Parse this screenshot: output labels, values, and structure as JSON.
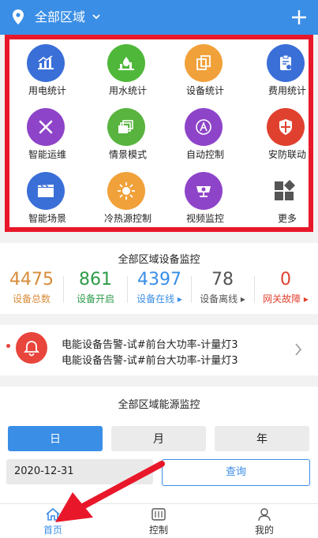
{
  "header": {
    "area_label": "全部区域"
  },
  "grid": [
    {
      "label": "用电统计",
      "icon": "power-chart-icon",
      "color": "#3a6fd8"
    },
    {
      "label": "用水统计",
      "icon": "water-chart-icon",
      "color": "#4fb83a"
    },
    {
      "label": "设备统计",
      "icon": "device-copy-icon",
      "color": "#f1a13a"
    },
    {
      "label": "费用统计",
      "icon": "clipboard-icon",
      "color": "#3a6fd8"
    },
    {
      "label": "智能运维",
      "icon": "tools-icon",
      "color": "#8e44c9"
    },
    {
      "label": "情景模式",
      "icon": "layers-icon",
      "color": "#58b43f"
    },
    {
      "label": "自动控制",
      "icon": "auto-a-icon",
      "color": "#8e44c9"
    },
    {
      "label": "安防联动",
      "icon": "shield-icon",
      "color": "#e0412f"
    },
    {
      "label": "智能场景",
      "icon": "clapper-icon",
      "color": "#3a6fd8"
    },
    {
      "label": "冷热源控制",
      "icon": "sun-snow-icon",
      "color": "#f1a13a"
    },
    {
      "label": "视频监控",
      "icon": "camera-icon",
      "color": "#8e44c9"
    },
    {
      "label": "更多",
      "icon": "more-grid-icon",
      "color": "#555555"
    }
  ],
  "monitor": {
    "title": "全部区域设备监控",
    "stats": [
      {
        "value": "4475",
        "label": "设备总数",
        "color": "#d98c3a"
      },
      {
        "value": "861",
        "label": "设备开启",
        "color": "#2e9b4a"
      },
      {
        "value": "4397",
        "label": "设备在线 ▸",
        "color": "#3a8ee6"
      },
      {
        "value": "78",
        "label": "设备离线 ▸",
        "color": "#555555"
      },
      {
        "value": "0",
        "label": "网关故障 ▸",
        "color": "#e0412f"
      }
    ]
  },
  "alerts": {
    "lines": [
      "电能设备告警-试#前台大功率-计量灯3",
      "电能设备告警-试#前台大功率-计量灯3"
    ]
  },
  "energy": {
    "title": "全部区域能源监控",
    "segments": [
      "日",
      "月",
      "年"
    ],
    "date": "2020-12-31",
    "query_label": "查询"
  },
  "tabbar": [
    {
      "label": "首页",
      "icon": "home-icon"
    },
    {
      "label": "控制",
      "icon": "control-icon"
    },
    {
      "label": "我的",
      "icon": "user-icon"
    }
  ]
}
